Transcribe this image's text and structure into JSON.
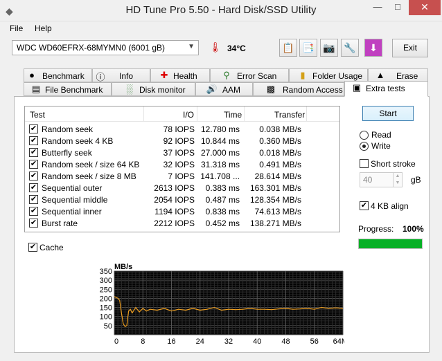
{
  "window": {
    "title": "HD Tune Pro 5.50 - Hard Disk/SSD Utility"
  },
  "menu": {
    "file": "File",
    "help": "Help"
  },
  "toolbar": {
    "drive": "WDC WD60EFRX-68MYMN0 (6001 gB)",
    "temperature": "34°C",
    "exit_label": "Exit"
  },
  "tabs_top": [
    {
      "label": "Benchmark",
      "icon": "benchmark-icon"
    },
    {
      "label": "Info",
      "icon": "info-icon"
    },
    {
      "label": "Health",
      "icon": "health-icon"
    },
    {
      "label": "Error Scan",
      "icon": "error-scan-icon"
    },
    {
      "label": "Folder Usage",
      "icon": "folder-icon"
    },
    {
      "label": "Erase",
      "icon": "erase-icon"
    }
  ],
  "tabs_bottom": [
    {
      "label": "File Benchmark",
      "icon": "file-benchmark-icon"
    },
    {
      "label": "Disk monitor",
      "icon": "disk-monitor-icon"
    },
    {
      "label": "AAM",
      "icon": "speaker-icon"
    },
    {
      "label": "Random Access",
      "icon": "random-access-icon"
    },
    {
      "label": "Extra tests",
      "icon": "extra-tests-icon"
    }
  ],
  "results": {
    "headers": {
      "test": "Test",
      "io": "I/O",
      "time": "Time",
      "transfer": "Transfer"
    },
    "rows": [
      {
        "checked": true,
        "test": "Random seek",
        "io": "78 IOPS",
        "time": "12.780 ms",
        "transfer": "0.038 MB/s"
      },
      {
        "checked": true,
        "test": "Random seek 4 KB",
        "io": "92 IOPS",
        "time": "10.844 ms",
        "transfer": "0.360 MB/s"
      },
      {
        "checked": true,
        "test": "Butterfly seek",
        "io": "37 IOPS",
        "time": "27.000 ms",
        "transfer": "0.018 MB/s"
      },
      {
        "checked": true,
        "test": "Random seek / size 64 KB",
        "io": "32 IOPS",
        "time": "31.318 ms",
        "transfer": "0.491 MB/s"
      },
      {
        "checked": true,
        "test": "Random seek / size 8 MB",
        "io": "7 IOPS",
        "time": "141.708 ...",
        "transfer": "28.614 MB/s"
      },
      {
        "checked": true,
        "test": "Sequential outer",
        "io": "2613 IOPS",
        "time": "0.383 ms",
        "transfer": "163.301 MB/s"
      },
      {
        "checked": true,
        "test": "Sequential middle",
        "io": "2054 IOPS",
        "time": "0.487 ms",
        "transfer": "128.354 MB/s"
      },
      {
        "checked": true,
        "test": "Sequential inner",
        "io": "1194 IOPS",
        "time": "0.838 ms",
        "transfer": "74.613 MB/s"
      },
      {
        "checked": true,
        "test": "Burst rate",
        "io": "2212 IOPS",
        "time": "0.452 ms",
        "transfer": "138.271 MB/s"
      }
    ]
  },
  "cache": {
    "label": "Cache",
    "checked": true
  },
  "controls": {
    "start_label": "Start",
    "read_label": "Read",
    "write_label": "Write",
    "mode": "write",
    "short_stroke_label": "Short stroke",
    "short_stroke_checked": false,
    "short_stroke_value": "40",
    "short_stroke_unit": "gB",
    "align_label": "4 KB align",
    "align_checked": true,
    "progress_label": "Progress:",
    "progress_text": "100%",
    "progress_value": 1.0,
    "progress_color": "#06b025"
  },
  "chart_data": {
    "type": "line",
    "ylabel": "MB/s",
    "y_ticks": [
      "350",
      "300",
      "250",
      "200",
      "150",
      "100",
      "50"
    ],
    "ylim": [
      0,
      350
    ],
    "x_ticks": [
      "0",
      "8",
      "16",
      "24",
      "32",
      "40",
      "48",
      "56",
      "64MB"
    ],
    "xlim": [
      0,
      64
    ],
    "line_color": "#f0a020",
    "background": "#000000",
    "grid": true,
    "series": [
      {
        "x": [
          0,
          0.5,
          1,
          1.5,
          2,
          2.5,
          3,
          3.5,
          4,
          4.5,
          5,
          6,
          7,
          8,
          9,
          10,
          12,
          14,
          16,
          18,
          20,
          22,
          24,
          26,
          28,
          30,
          32,
          34,
          36,
          38,
          40,
          42,
          44,
          46,
          48,
          50,
          52,
          54,
          56,
          58,
          60,
          62,
          64
        ],
        "y": [
          210,
          205,
          200,
          190,
          120,
          60,
          45,
          50,
          130,
          140,
          120,
          150,
          125,
          145,
          130,
          140,
          135,
          145,
          130,
          140,
          135,
          145,
          135,
          140,
          150,
          135,
          140,
          138,
          140,
          145,
          140,
          140,
          138,
          142,
          145,
          140,
          142,
          145,
          140,
          150,
          145,
          148,
          145
        ]
      }
    ]
  }
}
